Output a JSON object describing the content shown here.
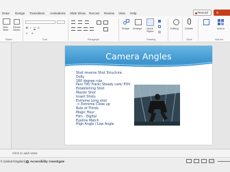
{
  "ribbon_tabs": [
    "Draw",
    "Design",
    "Transitions",
    "Animations",
    "Slide Show",
    "Record",
    "Review",
    "View",
    "Help"
  ],
  "record_label": "Record",
  "share_label": "S",
  "ribbon": {
    "new_slide_label": "New",
    "new_slide_label2": "Slide",
    "reuse_label": "Reuse",
    "reuse_label2": "Slides",
    "groups": [
      "Slides",
      "Font",
      "Paragraph",
      "Drawing",
      "Voice",
      "Add-ins"
    ],
    "shape_label": "Shape",
    "arrange_label": "Arrange",
    "quick_styles_label": "Quick",
    "quick_styles_label2": "Styles",
    "editing_label": "Editing",
    "dictate_label": "Dictate",
    "addins_label": "Add-in"
  },
  "slide": {
    "title": "Camera Angles",
    "bullets": [
      "Shot reverse Shot Structure.",
      "Dolly",
      "180 degree rule",
      "Pan/ Tilt/ Track/ Steady cam/ POV",
      "Establishing Shot",
      "Master Shot",
      "Insert Shots",
      "Extreme Long shot",
      "-> Extreme Close up",
      "Rule of Thirds",
      "Magic Hour",
      "Film - Digital",
      "Eyeline Match",
      "High Angle / Low Angle"
    ]
  },
  "notes_placeholder": "Click to add notes",
  "status": {
    "language": "h (United Kingdom)",
    "accessibility": "Accessibility: Investigate"
  },
  "colors": {
    "accent": "#c43e1c",
    "title_bar": "#3f96cf",
    "bullet_text": "#1d3f7a"
  }
}
